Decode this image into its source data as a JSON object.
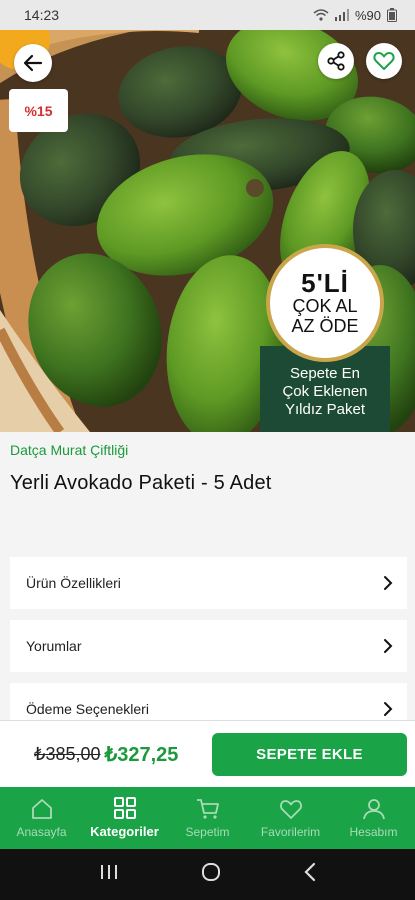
{
  "status_bar": {
    "time": "14:23",
    "battery": "%90"
  },
  "product": {
    "discount_badge": "%15",
    "promo_badge": {
      "count": "5'Lİ",
      "line1": "ÇOK AL",
      "line2": "AZ ÖDE"
    },
    "promo_box": {
      "line1": "Sepete En",
      "line2": "Çok Eklenen",
      "line3": "Yıldız Paket"
    },
    "brand": "Datça Murat Çiftliği",
    "title": "Yerli Avokado Paketi - 5 Adet"
  },
  "sections": [
    {
      "label": "Ürün Özellikleri"
    },
    {
      "label": "Yorumlar"
    },
    {
      "label": "Ödeme Seçenekleri"
    }
  ],
  "price": {
    "old": "₺385,00",
    "new": "₺327,25",
    "add_to_cart": "SEPETE EKLE"
  },
  "bottom_nav": [
    {
      "label": "Anasayfa",
      "icon": "home-icon"
    },
    {
      "label": "Kategoriler",
      "icon": "grid-icon",
      "active": true
    },
    {
      "label": "Sepetim",
      "icon": "cart-icon"
    },
    {
      "label": "Favorilerim",
      "icon": "heart-icon"
    },
    {
      "label": "Hesabım",
      "icon": "user-icon"
    }
  ],
  "colors": {
    "brand_green": "#1aa347",
    "discount_red": "#d32f2f",
    "promo_dark": "#1c4a35"
  }
}
